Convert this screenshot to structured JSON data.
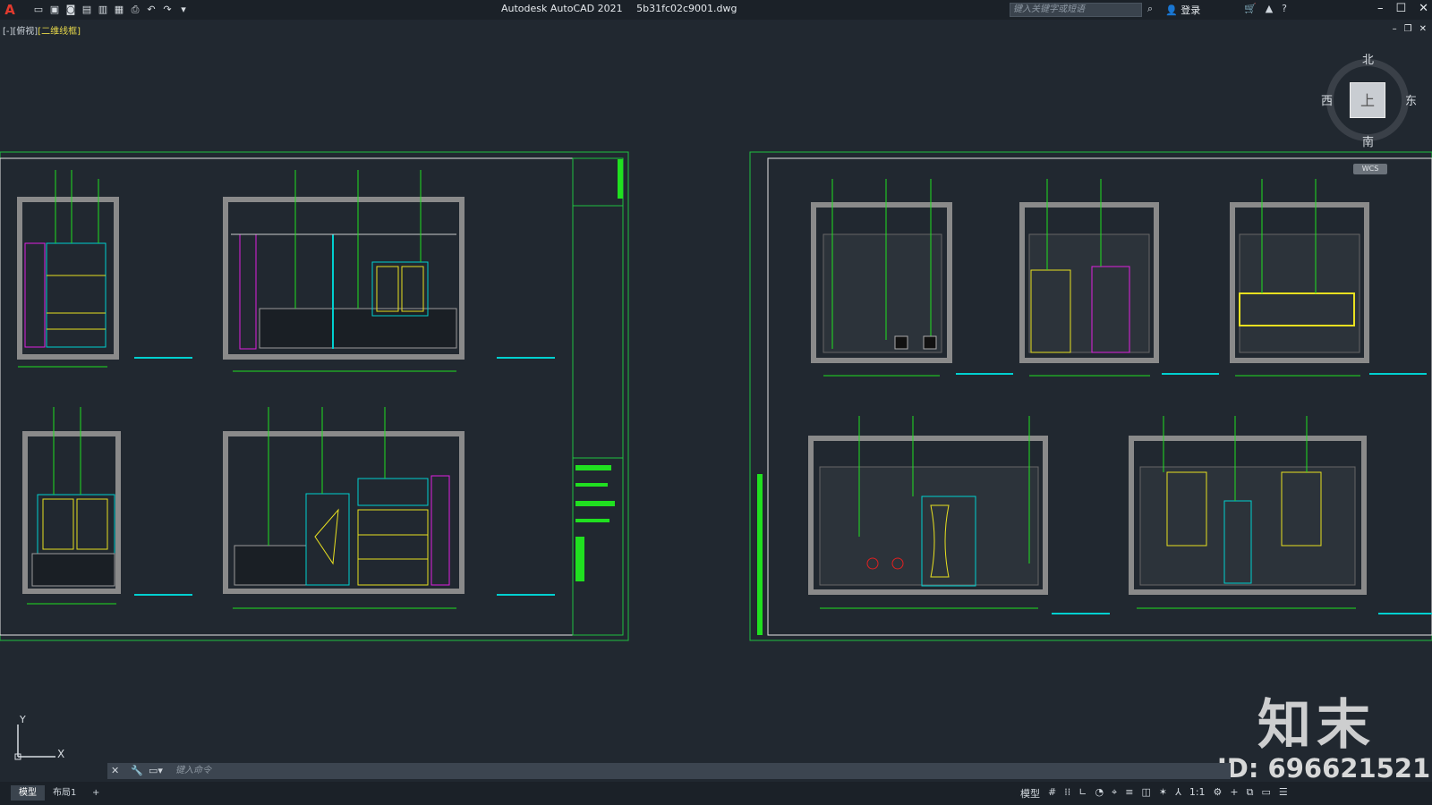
{
  "app": {
    "title": "Autodesk AutoCAD 2021",
    "file": "5b31fc02c9001.dwg",
    "logo": "A"
  },
  "search": {
    "placeholder": "键入关键字或短语"
  },
  "user": {
    "login_label": "登录"
  },
  "view_label": {
    "prefix": "[-][俯视]",
    "style": "[二维线框]"
  },
  "viewcube": {
    "north": "北",
    "south": "南",
    "west": "西",
    "east": "东",
    "face": "上",
    "wcs": "WCS"
  },
  "ucs": {
    "y": "Y",
    "x": "X"
  },
  "command": {
    "placeholder": "键入命令"
  },
  "layout_tabs": [
    {
      "label": "模型"
    },
    {
      "label": "布局1"
    },
    {
      "label": "+"
    }
  ],
  "status": {
    "model_label": "模型",
    "scale": "1:1"
  },
  "watermark": {
    "brand": "知末",
    "id": "ID: 696621521"
  },
  "colors": {
    "background": "#212830",
    "accent_green": "#20e020",
    "cyan": "#00e5e5",
    "magenta": "#e020e0",
    "yellow": "#e8e020"
  }
}
